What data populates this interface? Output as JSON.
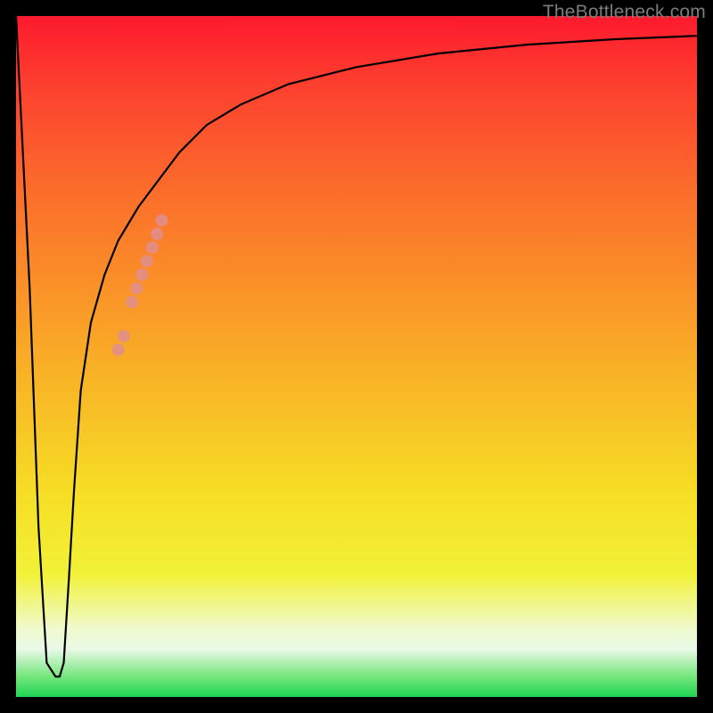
{
  "watermark": "TheBottleneck.com",
  "chart_data": {
    "type": "line",
    "title": "",
    "xlabel": "",
    "ylabel": "",
    "xlim": [
      0,
      100
    ],
    "ylim": [
      0,
      100
    ],
    "grid": false,
    "legend": false,
    "background_gradient": {
      "direction": "vertical",
      "stops": [
        {
          "pos": 0,
          "color": "#fd1a2d"
        },
        {
          "pos": 25,
          "color": "#fb6b2b"
        },
        {
          "pos": 55,
          "color": "#f8b826"
        },
        {
          "pos": 82,
          "color": "#f2f238"
        },
        {
          "pos": 93,
          "color": "#e9f9e6"
        },
        {
          "pos": 100,
          "color": "#1ed552"
        }
      ]
    },
    "series": [
      {
        "name": "bottleneck-curve",
        "x": [
          0.0,
          2.0,
          3.3,
          4.5,
          5.8,
          6.4,
          7.0,
          7.8,
          8.5,
          9.5,
          11.0,
          13.0,
          15.0,
          18.0,
          21.0,
          24.0,
          28.0,
          33.0,
          40.0,
          50.0,
          62.0,
          75.0,
          88.0,
          100.0
        ],
        "y": [
          100.0,
          60.0,
          25.0,
          5.0,
          3.0,
          3.0,
          5.0,
          18.0,
          30.0,
          45.0,
          55.0,
          62.0,
          67.0,
          72.0,
          76.0,
          80.0,
          84.0,
          87.0,
          90.0,
          92.5,
          94.5,
          95.8,
          96.6,
          97.1
        ],
        "color": "#000000",
        "linewidth": 2.2
      }
    ],
    "markers": {
      "name": "highlight-dots",
      "color": "#e08e8e",
      "radius_px": 7,
      "points_xy": [
        [
          15.0,
          51.0
        ],
        [
          15.8,
          53.0
        ],
        [
          17.0,
          58.0
        ],
        [
          17.7,
          60.0
        ],
        [
          18.5,
          62.0
        ],
        [
          19.2,
          64.0
        ],
        [
          20.0,
          66.0
        ],
        [
          20.7,
          68.0
        ],
        [
          21.4,
          70.0
        ]
      ]
    }
  }
}
